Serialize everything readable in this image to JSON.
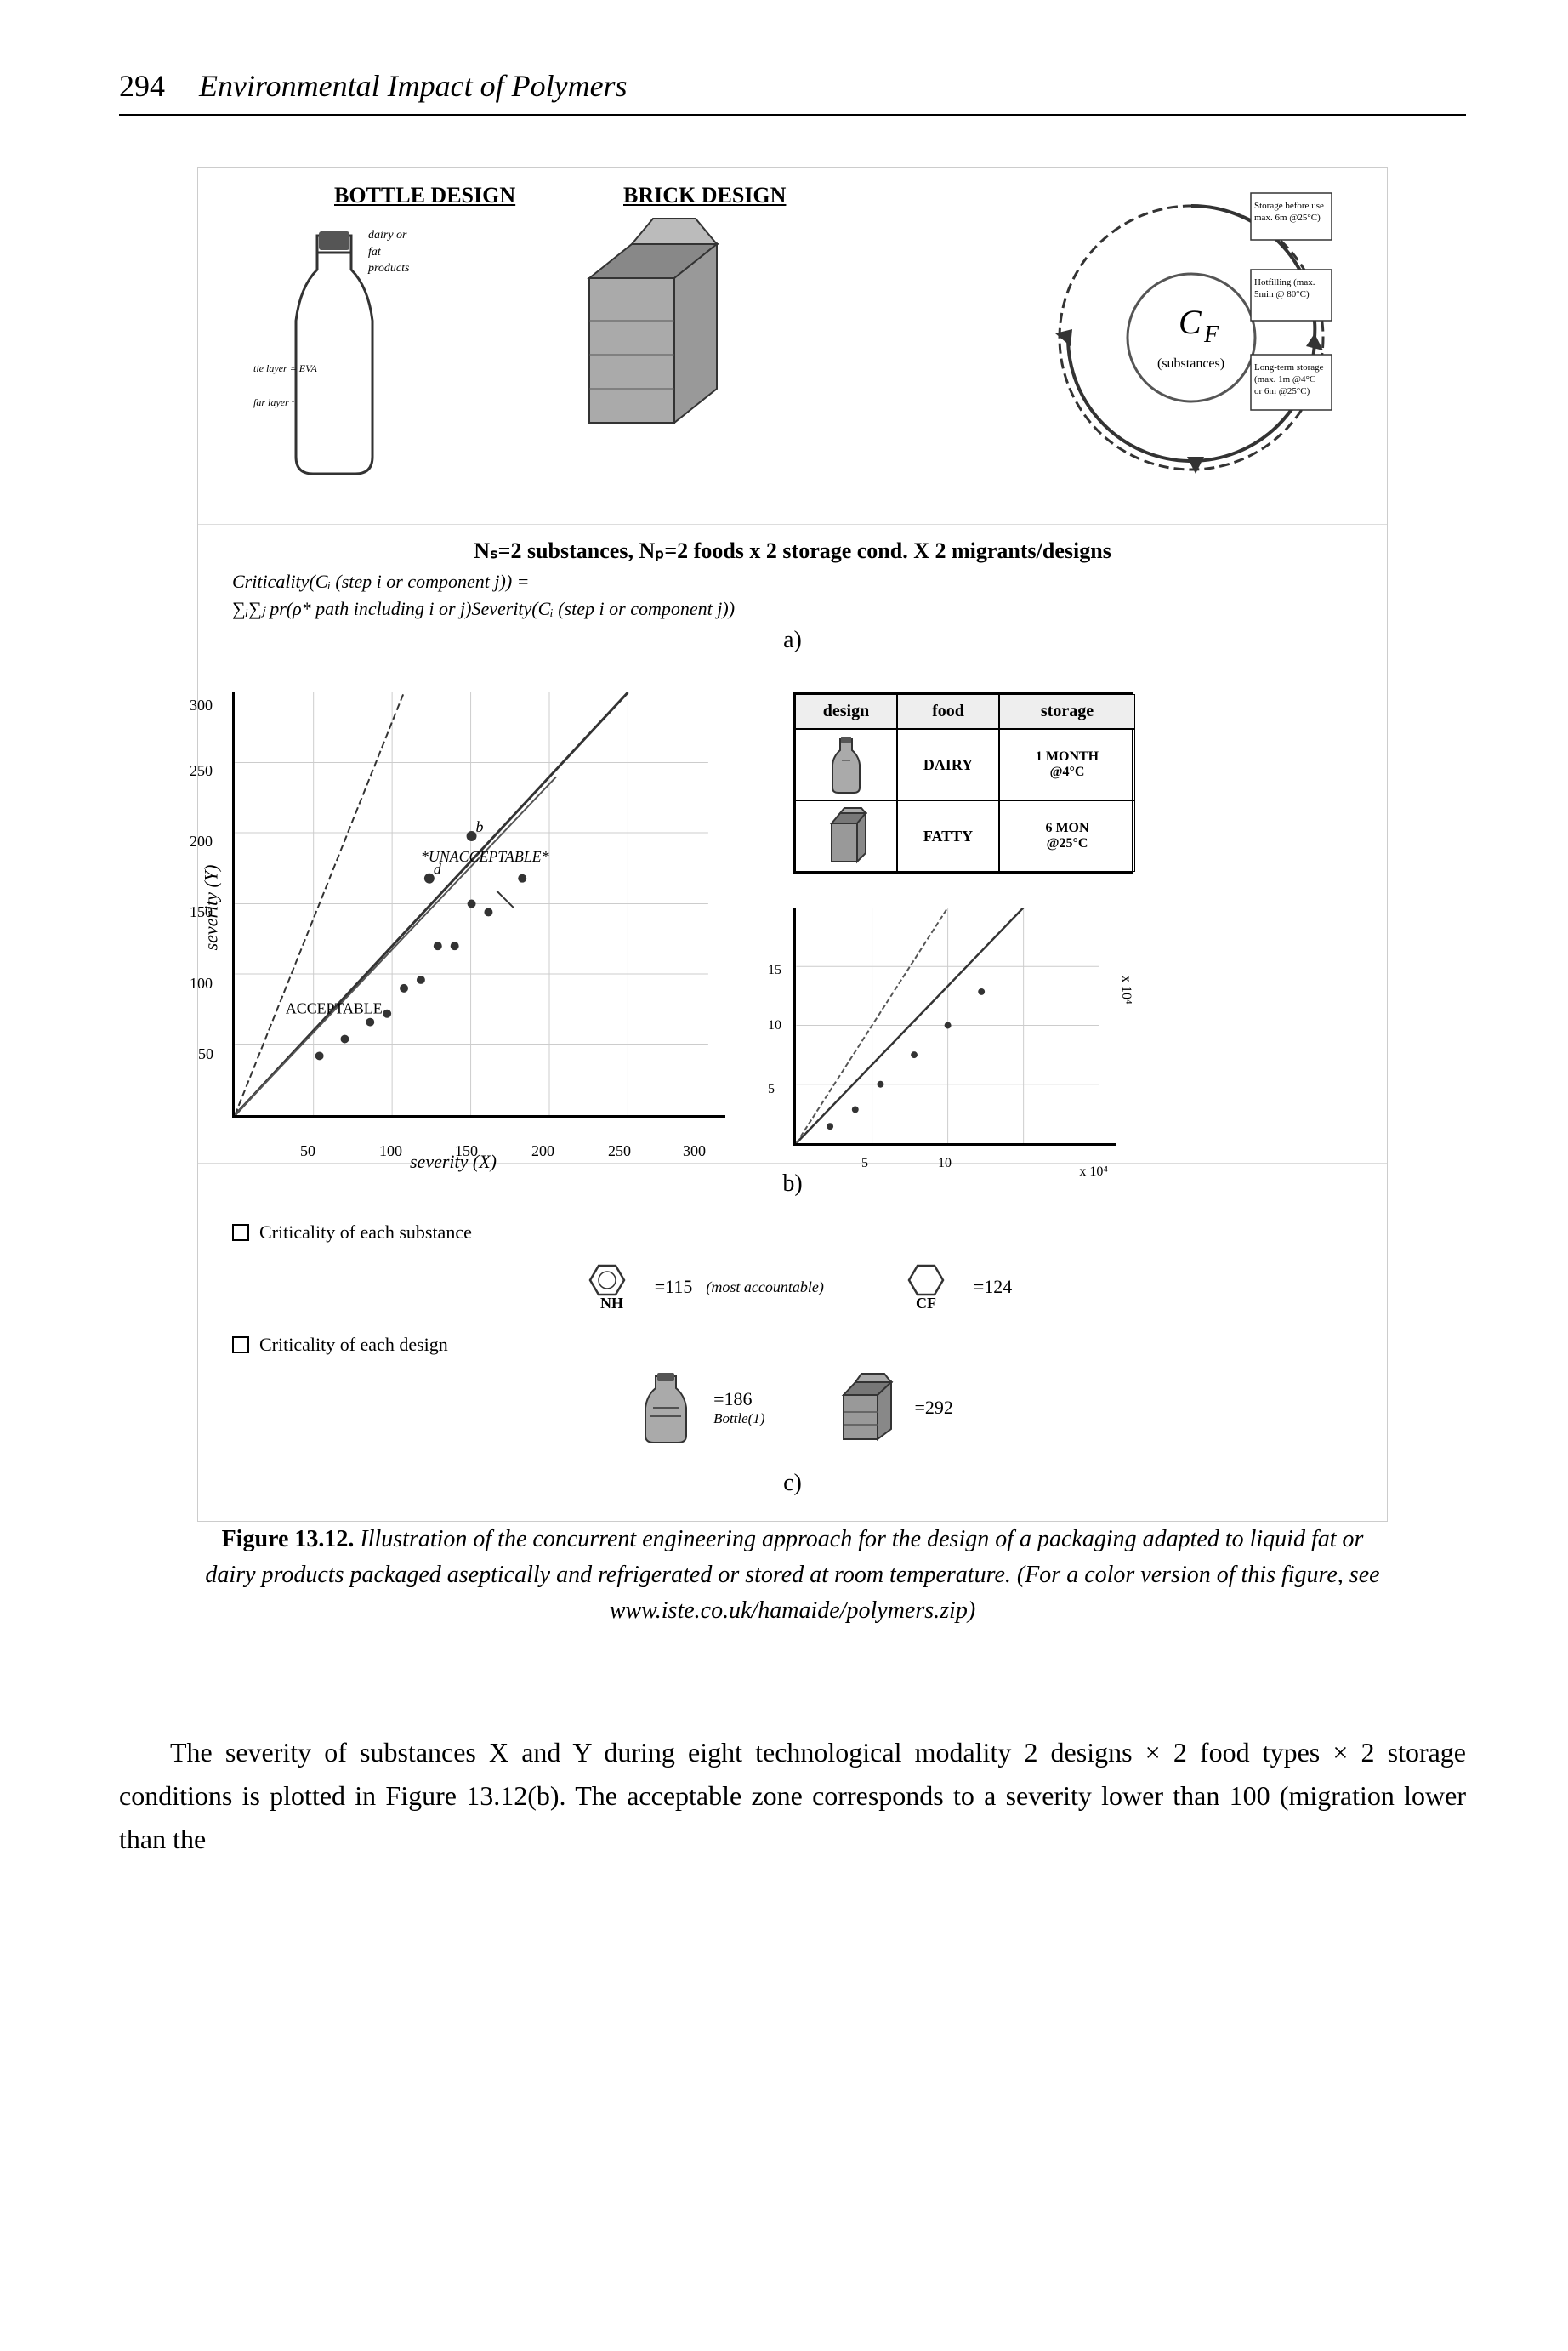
{
  "header": {
    "page_number": "294",
    "title": "Environmental Impact of Polymers"
  },
  "figure": {
    "label": "Figure 13.12.",
    "caption_italic": "Illustration of the concurrent engineering approach for the design of a packaging adapted to liquid fat or dairy products packaged aseptically and refrigerated or stored at room temperature. (For a color version of this figure, see www.iste.co.uk/hamaide/polymers.zip)",
    "top_labels": {
      "bottle_design": "BOTTLE DESIGN",
      "brick_design": "BRICK DESIGN",
      "cf_label": "C",
      "cf_subscript": "F"
    },
    "formula": {
      "title": "Nₛ=2 substances, Nₚ=2 foods x 2 storage cond. X 2 migrants/designs",
      "line1": "Criticality(Cᵢ (step i or component j)) =",
      "line2": "∑ᵢ∑ⱼ pr(ρ* path including i or j)Severity(Cᵢ (step i or component j))"
    },
    "section_a": "a)",
    "section_b": "b)",
    "section_c": "c)",
    "chart_left": {
      "y_axis_label": "severity (Y)",
      "x_axis_label": "severity (X)",
      "y_ticks": [
        "50",
        "100",
        "150",
        "200",
        "250",
        "300"
      ],
      "x_ticks": [
        "50",
        "100",
        "150",
        "200",
        "250",
        "300"
      ],
      "unacceptable_label": "*UNACCEPTABLE*",
      "acceptable_label": "ACCEPTABLE"
    },
    "right_table": {
      "headers": [
        "design",
        "food",
        "storage"
      ],
      "rows": [
        {
          "design_icon": "bottle",
          "food": "DAIRY",
          "storage": "1 MONTH\n@4°C"
        },
        {
          "design_icon": "carton",
          "food": "FATTY",
          "storage": "6 MON\n@25°C"
        }
      ]
    },
    "legend": {
      "criticality_substance": "Criticality of each substance",
      "criticality_design": "Criticality of each design"
    },
    "substances": [
      {
        "molecule": "NH",
        "value": "=115",
        "note": "(most accountable)"
      },
      {
        "molecule": "CF",
        "value": "=124"
      }
    ],
    "designs": [
      {
        "icon": "bottle_design",
        "value": "=186",
        "note": "Bottle(1)"
      },
      {
        "icon": "brick_design",
        "value": "=292"
      }
    ]
  },
  "body_text": {
    "paragraph1": "The severity of substances X and Y during eight technological modality 2 designs × 2 food types × 2 storage conditions is plotted in Figure 13.12(b). The acceptable zone corresponds to a severity lower than 100 (migration lower than the"
  },
  "colors": {
    "background": "#ffffff",
    "text": "#000000",
    "border": "#000000",
    "light_gray": "#cccccc"
  }
}
